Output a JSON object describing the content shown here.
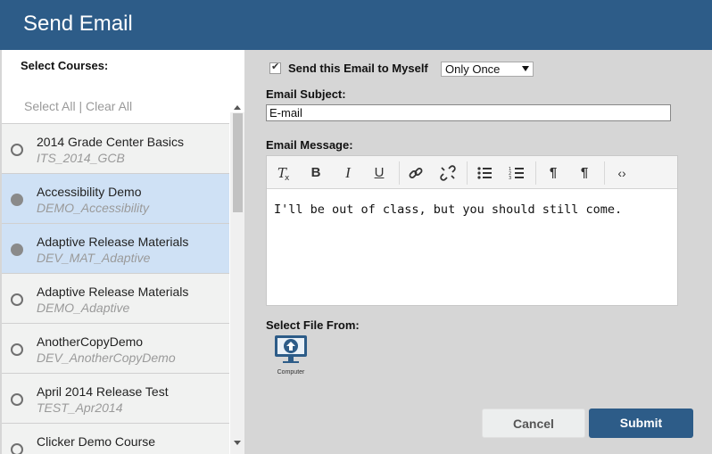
{
  "header": {
    "title": "Send Email"
  },
  "courses": {
    "label": "Select Courses:",
    "select_all": "Select All",
    "divider": "|",
    "clear_all": "Clear All",
    "items": [
      {
        "name": "2014 Grade Center Basics",
        "code": "ITS_2014_GCB",
        "selected": false
      },
      {
        "name": "Accessibility Demo",
        "code": "DEMO_Accessibility",
        "selected": true
      },
      {
        "name": "Adaptive Release Materials",
        "code": "DEV_MAT_Adaptive",
        "selected": true
      },
      {
        "name": "Adaptive Release Materials",
        "code": "DEMO_Adaptive",
        "selected": false
      },
      {
        "name": "AnotherCopyDemo",
        "code": "DEV_AnotherCopyDemo",
        "selected": false
      },
      {
        "name": "April 2014 Release Test",
        "code": "TEST_Apr2014",
        "selected": false
      },
      {
        "name": "Clicker Demo Course",
        "code": "",
        "selected": false
      }
    ]
  },
  "form": {
    "send_myself_label": "Send this Email to Myself",
    "send_myself_checked": true,
    "frequency_value": "Only Once",
    "subject_label": "Email Subject:",
    "subject_value": "E-mail",
    "message_label": "Email Message:",
    "message_text": "I'll be out of class, but you should still come.",
    "file_label": "Select File From:",
    "computer_caption": "Computer"
  },
  "toolbar_icons": [
    "remove-format-icon",
    "bold-icon",
    "italic-icon",
    "underline-icon",
    "link-icon",
    "unlink-icon",
    "bulleted-list-icon",
    "numbered-list-icon",
    "ltr-paragraph-icon",
    "rtl-paragraph-icon",
    "source-code-icon"
  ],
  "buttons": {
    "cancel": "Cancel",
    "submit": "Submit"
  },
  "colors": {
    "header": "#2d5c88",
    "selected_row": "#cfe1f5",
    "submit": "#2d5c88"
  }
}
